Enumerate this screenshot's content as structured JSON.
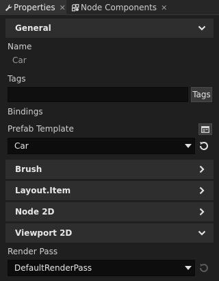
{
  "tabs": [
    {
      "label": "Properties",
      "icon": "wrench-icon",
      "active": true
    },
    {
      "label": "Node Components",
      "icon": "components-icon",
      "active": false
    }
  ],
  "general": {
    "title": "General",
    "name_label": "Name",
    "name_value": "Car",
    "tags_label": "Tags",
    "tags_value": "",
    "tags_button": "Tags",
    "bindings_label": "Bindings",
    "prefab_label": "Prefab Template",
    "prefab_value": "Car"
  },
  "sections": {
    "brush": "Brush",
    "layout_item": "Layout.Item",
    "node2d": "Node 2D",
    "viewport2d": "Viewport 2D"
  },
  "viewport2d": {
    "render_pass_label": "Render Pass",
    "render_pass_value": "DefaultRenderPass"
  }
}
